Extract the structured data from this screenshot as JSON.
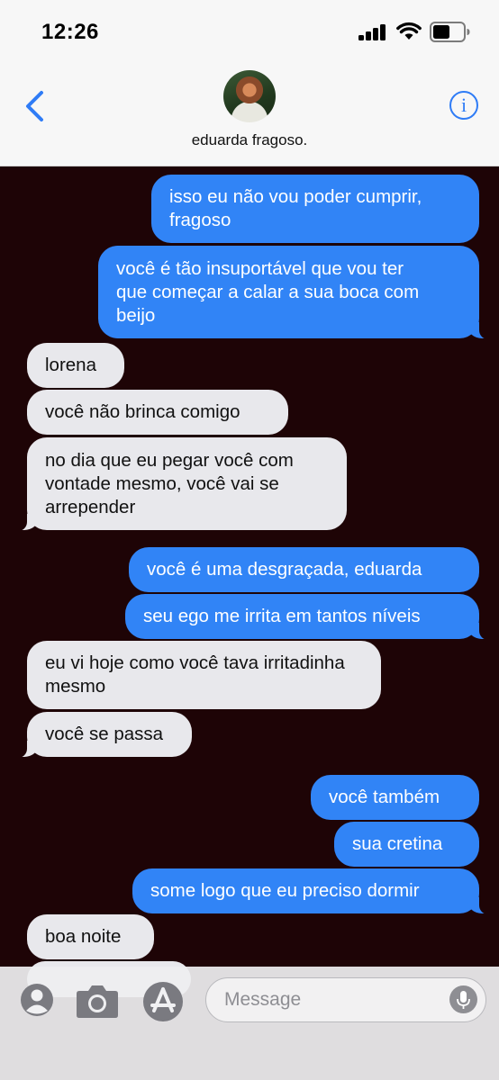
{
  "status_bar": {
    "time": "12:26"
  },
  "header": {
    "contact_name": "eduarda fragoso.",
    "info_glyph": "i"
  },
  "messages": [
    {
      "from": "me",
      "lines": [
        "isso eu não vou poder cumprir,",
        "fragoso"
      ]
    },
    {
      "from": "me",
      "lines": [
        "você é tão insuportável que vou ter",
        "que começar a calar a sua boca com",
        "beijo"
      ]
    },
    {
      "from": "them",
      "lines": [
        "lorena"
      ]
    },
    {
      "from": "them",
      "lines": [
        "você não brinca comigo"
      ]
    },
    {
      "from": "them",
      "lines": [
        "no dia que eu pegar você com",
        "vontade mesmo, você vai se",
        "arrepender"
      ]
    },
    {
      "from": "me",
      "lines": [
        "você é uma desgraçada, eduarda"
      ]
    },
    {
      "from": "me",
      "lines": [
        "seu ego me irrita em tantos níveis"
      ]
    },
    {
      "from": "them",
      "lines": [
        "eu vi hoje como você tava irritadinha",
        "mesmo"
      ]
    },
    {
      "from": "them",
      "lines": [
        "você se passa"
      ]
    },
    {
      "from": "me",
      "lines": [
        "você também"
      ]
    },
    {
      "from": "me",
      "lines": [
        "sua cretina"
      ]
    },
    {
      "from": "me",
      "lines": [
        "some logo que eu preciso dormir"
      ]
    },
    {
      "from": "them",
      "lines": [
        "boa noite"
      ]
    }
  ],
  "input": {
    "placeholder": "Message"
  },
  "colors": {
    "sent_bubble": "#3184f6",
    "received_bubble": "#e8e8ec",
    "background": "#1e0406",
    "accent": "#2f7cf6"
  },
  "icons": [
    "back-chevron-icon",
    "info-icon",
    "contacts-icon",
    "camera-icon",
    "app-store-icon",
    "microphone-icon"
  ]
}
